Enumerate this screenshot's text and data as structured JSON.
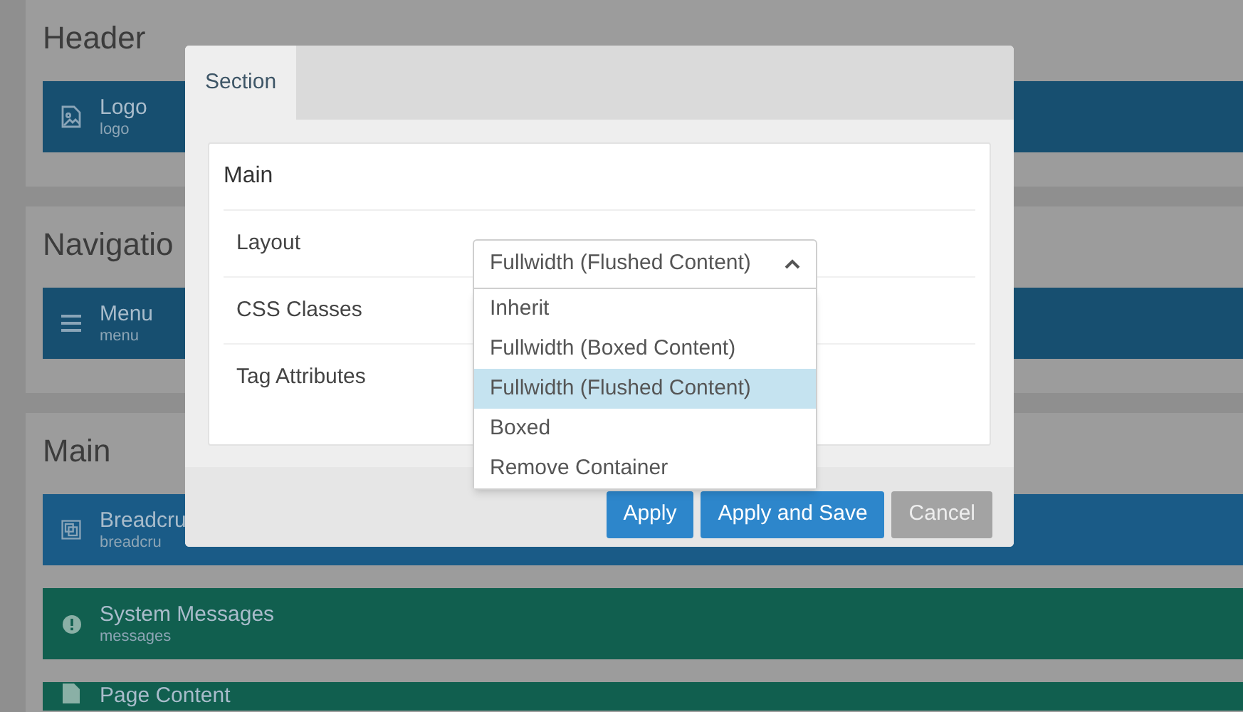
{
  "sections": [
    {
      "title": "Header",
      "blocks": [
        {
          "kind": "image",
          "title": "Logo",
          "subtitle": "logo",
          "color": "#174f70"
        }
      ]
    },
    {
      "title": "Navigatio",
      "blocks": [
        {
          "kind": "menu",
          "title": "Menu",
          "subtitle": "menu",
          "color": "#174f70"
        }
      ]
    },
    {
      "title": "Main",
      "blocks": [
        {
          "kind": "frame",
          "title": "Breadcru",
          "subtitle": "breadcru",
          "color": "#1a5b87"
        },
        {
          "kind": "alert",
          "title": "System Messages",
          "subtitle": "messages",
          "color": "#115f4f"
        },
        {
          "kind": "page",
          "title": "Page Content",
          "color": "#115f4f"
        }
      ]
    }
  ],
  "modal": {
    "tabs": [
      {
        "label": "Section",
        "selected": true
      }
    ],
    "panel": {
      "title": "Main",
      "fields": [
        {
          "kind": "select",
          "label": "Layout",
          "value": "Fullwidth (Flushed Content)",
          "expanded": true,
          "options": [
            {
              "label": "Inherit",
              "selected": false
            },
            {
              "label": "Fullwidth (Boxed Content)",
              "selected": false
            },
            {
              "label": "Fullwidth (Flushed Content)",
              "selected": true
            },
            {
              "label": "Boxed",
              "selected": false
            },
            {
              "label": "Remove Container",
              "selected": false
            }
          ]
        },
        {
          "kind": "text",
          "label": "CSS Classes"
        },
        {
          "kind": "text",
          "label": "Tag Attributes"
        }
      ]
    },
    "buttons": [
      {
        "kind": "primary",
        "label": "Apply"
      },
      {
        "kind": "primary",
        "label": "Apply and Save"
      },
      {
        "kind": "secondary",
        "label": "Cancel"
      }
    ]
  }
}
